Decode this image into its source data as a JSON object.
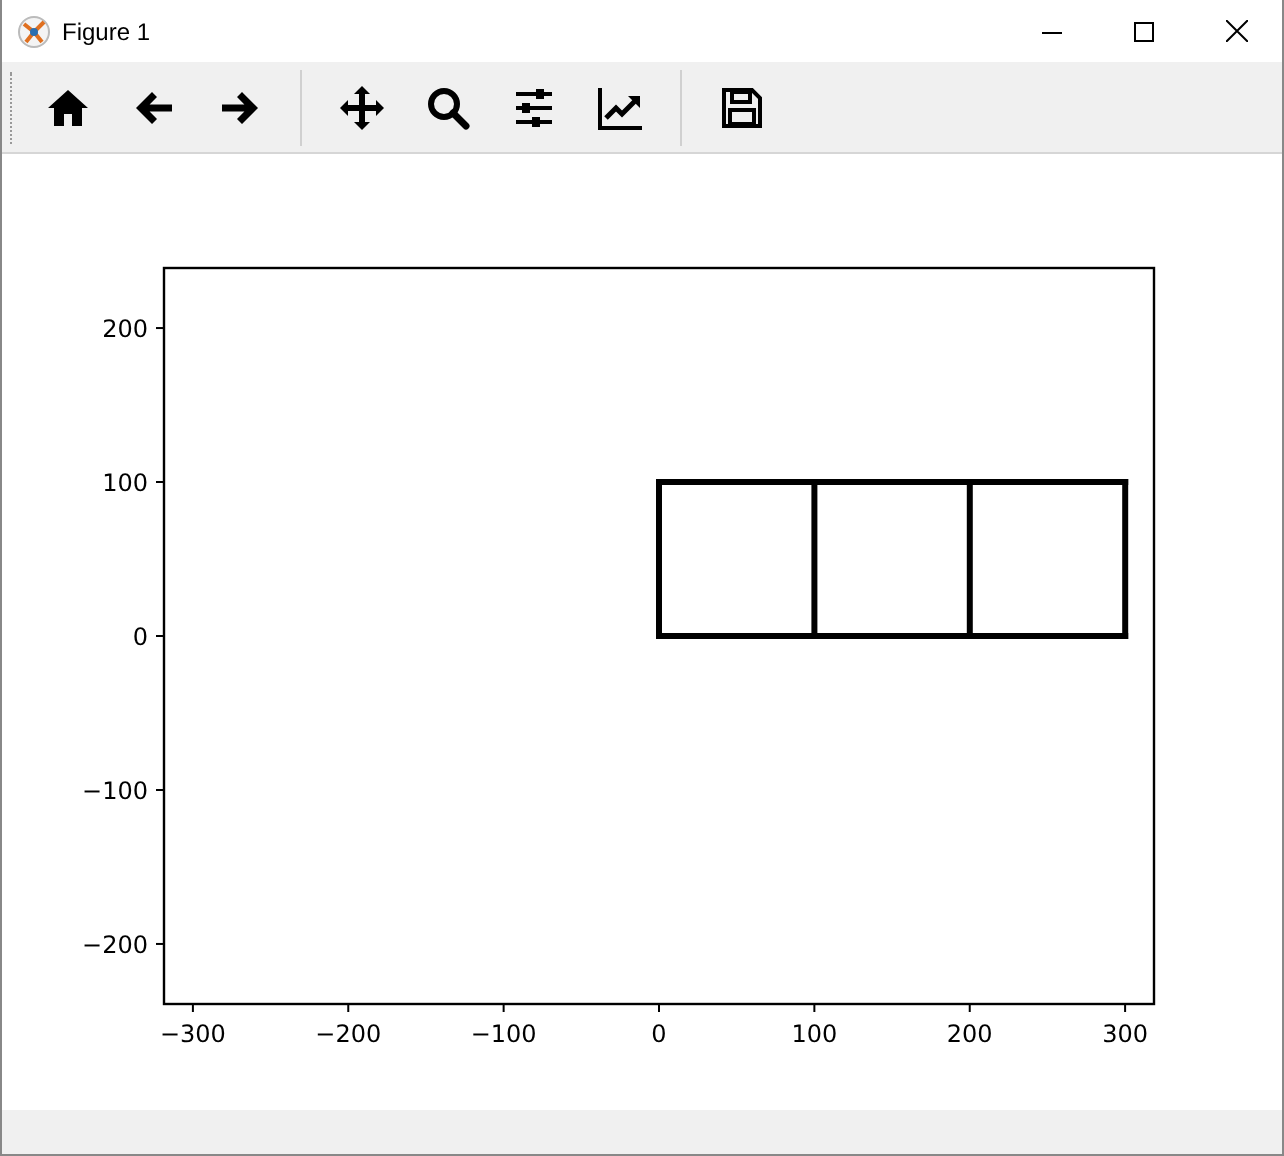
{
  "window": {
    "title": "Figure 1"
  },
  "figure": {
    "chart_data": {
      "type": "line",
      "xlim": [
        -318.6,
        318.6
      ],
      "ylim": [
        -239,
        239
      ],
      "xticks": [
        {
          "value": -300,
          "label": "−300"
        },
        {
          "value": -200,
          "label": "−200"
        },
        {
          "value": -100,
          "label": "−100"
        },
        {
          "value": 0,
          "label": "0"
        },
        {
          "value": 100,
          "label": "100"
        },
        {
          "value": 200,
          "label": "200"
        },
        {
          "value": 300,
          "label": "300"
        }
      ],
      "yticks": [
        {
          "value": -200,
          "label": "−200"
        },
        {
          "value": -100,
          "label": "−100"
        },
        {
          "value": 0,
          "label": "0"
        },
        {
          "value": 100,
          "label": "100"
        },
        {
          "value": 200,
          "label": "200"
        }
      ],
      "x": [
        0,
        300
      ],
      "series": [
        {
          "color": "#000000",
          "values": [
            0,
            0
          ]
        },
        {
          "color": "#000000",
          "values": [
            100,
            100
          ]
        }
      ],
      "ref_lines": [
        {
          "axis": "x",
          "value": 0,
          "color": "#000000"
        },
        {
          "axis": "x",
          "value": 100,
          "color": "#000000"
        },
        {
          "axis": "x",
          "value": 200,
          "color": "#000000"
        },
        {
          "axis": "x",
          "value": 300,
          "color": "#000000"
        }
      ]
    }
  }
}
